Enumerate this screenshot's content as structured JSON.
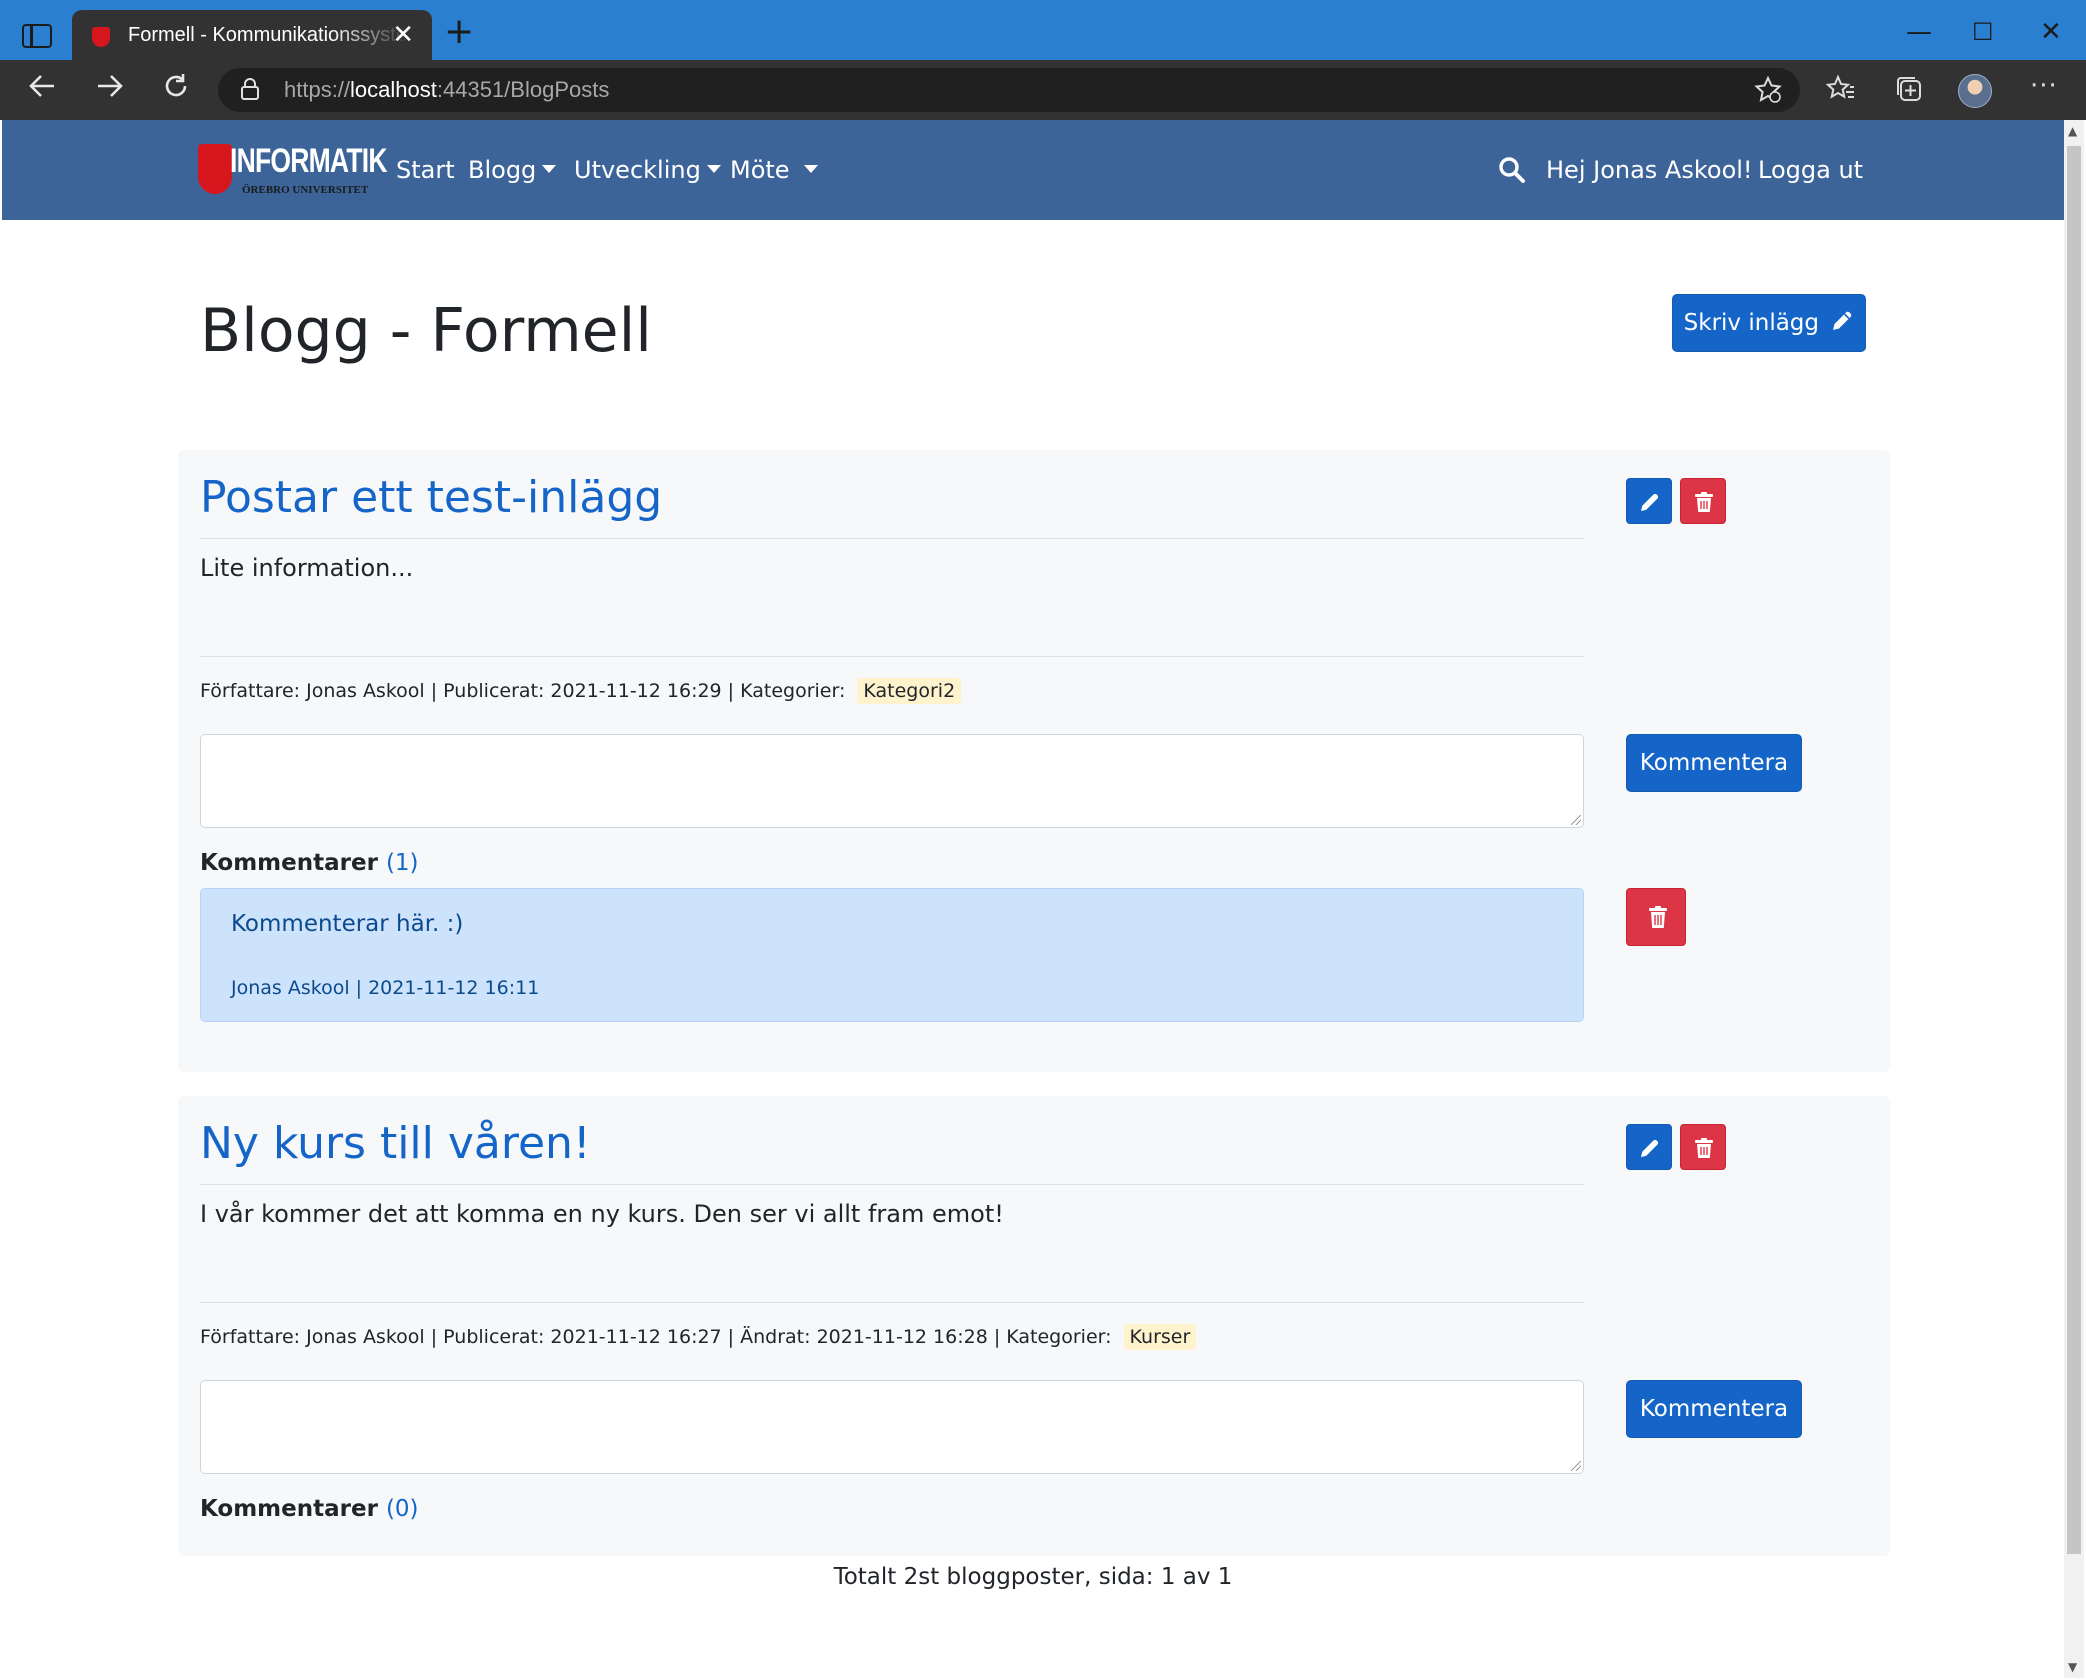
{
  "browser": {
    "tab_title": "Formell - Kommunikationssystem",
    "tab_close": "✕",
    "new_tab": "+",
    "url_scheme": "https://",
    "url_host": "localhost",
    "url_rest": ":44351/BlogPosts",
    "window_minimize": "—",
    "window_maximize": "☐",
    "window_close": "✕"
  },
  "navbar": {
    "logo_text": "INFORMATIK",
    "logo_subtext": "ÖREBRO UNIVERSITET",
    "links": [
      "Start",
      "Blogg",
      "Utveckling",
      "Möte"
    ],
    "greeting": "Hej Jonas Askool!",
    "logout": "Logga ut"
  },
  "page": {
    "title": "Blogg - Formell",
    "write_button": "Skriv inlägg"
  },
  "posts": [
    {
      "title": "Postar ett test-inlägg",
      "body": "Lite information...",
      "meta": "Författare: Jonas Askool | Publicerat: 2021-11-12 16:29 | Kategorier:",
      "category": "Kategori2",
      "comment_button": "Kommentera",
      "comments_label": "Kommentarer",
      "comments_count": "(1)",
      "comments": [
        {
          "text": "Kommenterar här. :)",
          "meta": "Jonas Askool | 2021-11-12 16:11"
        }
      ]
    },
    {
      "title": "Ny kurs till våren!",
      "body": "I vår kommer det att komma en ny kurs. Den ser vi allt fram emot!",
      "meta": "Författare: Jonas Askool | Publicerat: 2021-11-12 16:27 | Ändrat: 2021-11-12 16:28 | Kategorier:",
      "category": "Kurser",
      "comment_button": "Kommentera",
      "comments_label": "Kommentarer",
      "comments_count": "(0)",
      "comments": []
    }
  ],
  "footer": {
    "pager": "Totalt 2st bloggposter, sida: 1 av 1"
  },
  "colors": {
    "navbar": "#3c6499",
    "primary": "#1565c8",
    "danger": "#dc3545",
    "comment_bg": "#cce3fb",
    "category_badge": "#fff3cd"
  }
}
